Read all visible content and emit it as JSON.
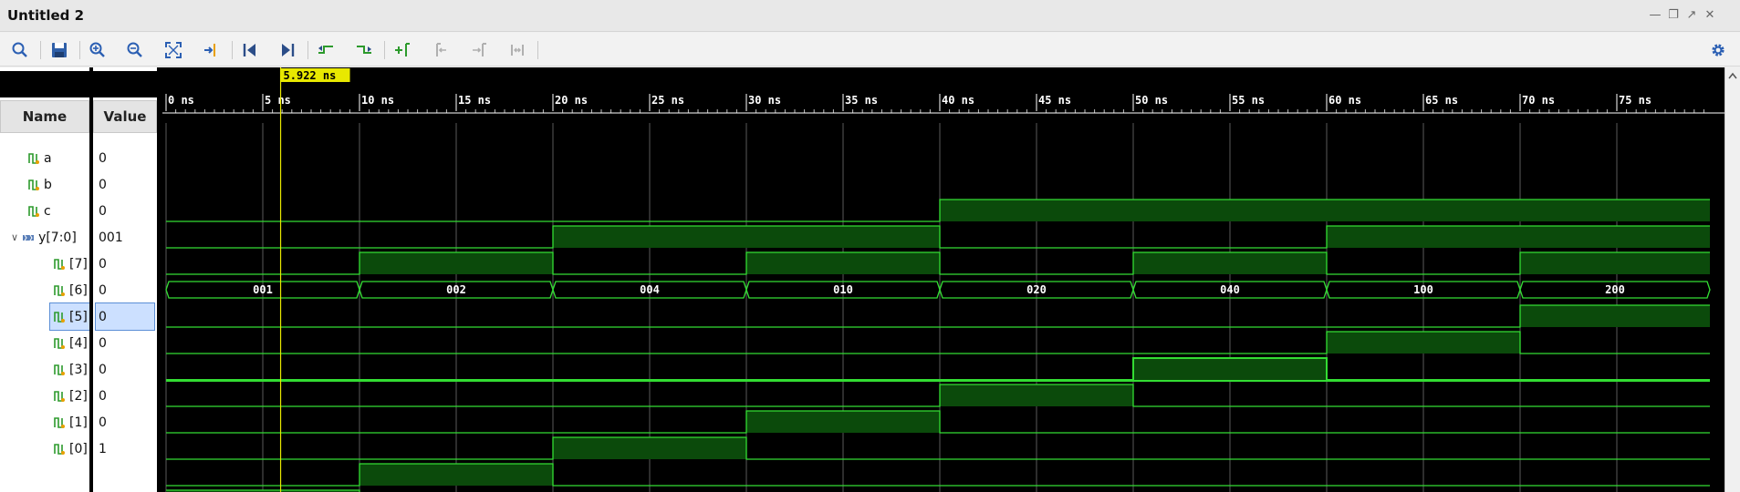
{
  "window": {
    "title": "Untitled 2"
  },
  "toolbar": {
    "buttons": [
      {
        "name": "search-icon"
      },
      {
        "name": "save-icon"
      },
      {
        "name": "zoom-in-icon"
      },
      {
        "name": "zoom-out-icon"
      },
      {
        "name": "zoom-fit-icon"
      },
      {
        "name": "go-to-cursor-icon"
      },
      {
        "name": "go-to-time-zero-icon"
      },
      {
        "name": "go-to-last-time-icon"
      },
      {
        "name": "previous-transition-icon"
      },
      {
        "name": "next-transition-icon"
      },
      {
        "name": "add-marker-icon"
      },
      {
        "name": "previous-marker-icon"
      },
      {
        "name": "next-marker-icon"
      },
      {
        "name": "swap-cursors-icon"
      }
    ],
    "settings_icon": "gear-icon"
  },
  "columns": {
    "name": "Name",
    "value": "Value"
  },
  "cursor": {
    "label": "5.922 ns",
    "time_ns": 5.922
  },
  "timeline": {
    "unit": "ns",
    "range_ns": [
      0,
      80
    ],
    "major_ticks": [
      "0 ns",
      "5 ns",
      "10 ns",
      "15 ns",
      "20 ns",
      "25 ns",
      "30 ns",
      "35 ns",
      "40 ns",
      "45 ns",
      "50 ns",
      "55 ns",
      "60 ns",
      "65 ns",
      "70 ns",
      "75 ns"
    ]
  },
  "signals": [
    {
      "name": "a",
      "value": "0",
      "kind": "bit",
      "waveform": [
        [
          0,
          0
        ],
        [
          40,
          1
        ]
      ]
    },
    {
      "name": "b",
      "value": "0",
      "kind": "bit",
      "waveform": [
        [
          0,
          0
        ],
        [
          20,
          1
        ],
        [
          40,
          0
        ],
        [
          60,
          1
        ]
      ]
    },
    {
      "name": "c",
      "value": "0",
      "kind": "bit",
      "waveform": [
        [
          0,
          0
        ],
        [
          10,
          1
        ],
        [
          20,
          0
        ],
        [
          30,
          1
        ],
        [
          40,
          0
        ],
        [
          50,
          1
        ],
        [
          60,
          0
        ],
        [
          70,
          1
        ]
      ]
    },
    {
      "name": "y[7:0]",
      "value": "001",
      "kind": "bus",
      "expanded": true,
      "bus_segments": [
        [
          0,
          "001"
        ],
        [
          10,
          "002"
        ],
        [
          20,
          "004"
        ],
        [
          30,
          "010"
        ],
        [
          40,
          "020"
        ],
        [
          50,
          "040"
        ],
        [
          60,
          "100"
        ],
        [
          70,
          "200"
        ]
      ]
    },
    {
      "name": "[7]",
      "value": "0",
      "kind": "bit",
      "child": true,
      "waveform": [
        [
          0,
          0
        ],
        [
          70,
          1
        ]
      ]
    },
    {
      "name": "[6]",
      "value": "0",
      "kind": "bit",
      "child": true,
      "waveform": [
        [
          0,
          0
        ],
        [
          60,
          1
        ],
        [
          70,
          0
        ]
      ]
    },
    {
      "name": "[5]",
      "value": "0",
      "kind": "bit",
      "child": true,
      "selected": true,
      "waveform": [
        [
          0,
          0
        ],
        [
          50,
          1
        ],
        [
          60,
          0
        ]
      ]
    },
    {
      "name": "[4]",
      "value": "0",
      "kind": "bit",
      "child": true,
      "waveform": [
        [
          0,
          0
        ],
        [
          40,
          1
        ],
        [
          50,
          0
        ]
      ]
    },
    {
      "name": "[3]",
      "value": "0",
      "kind": "bit",
      "child": true,
      "waveform": [
        [
          0,
          0
        ],
        [
          30,
          1
        ],
        [
          40,
          0
        ]
      ]
    },
    {
      "name": "[2]",
      "value": "0",
      "kind": "bit",
      "child": true,
      "waveform": [
        [
          0,
          0
        ],
        [
          20,
          1
        ],
        [
          30,
          0
        ]
      ]
    },
    {
      "name": "[1]",
      "value": "0",
      "kind": "bit",
      "child": true,
      "waveform": [
        [
          0,
          0
        ],
        [
          10,
          1
        ],
        [
          20,
          0
        ]
      ]
    },
    {
      "name": "[0]",
      "value": "1",
      "kind": "bit",
      "child": true,
      "waveform": [
        [
          0,
          1
        ],
        [
          10,
          0
        ]
      ]
    }
  ],
  "colors": {
    "wave_bg": "#000000",
    "wave_line": "#33dd33",
    "wave_fill": "#0b4a0b",
    "grid": "#5a5a5a",
    "cursor": "#e8e800",
    "selected_bg": "#cce0ff"
  }
}
